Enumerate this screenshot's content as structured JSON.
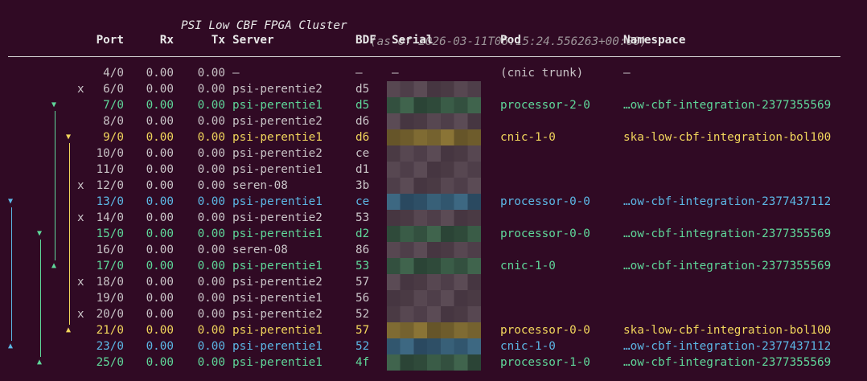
{
  "title": {
    "main": "PSI Low CBF FPGA Cluster",
    "as_of": "(as of 2026-03-11T06:15:24.556263+00:00)"
  },
  "columns": {
    "port": "Port",
    "rx": "Rx",
    "tx": "Tx",
    "server": "Server",
    "bdf": "BDF",
    "serial": "Serial",
    "pod": "Pod",
    "namespace": "Namespace"
  },
  "colors": {
    "background": "#300a24",
    "dim": "#c9c4c7",
    "green": "#5fd89a",
    "yellow": "#f2d65c",
    "blue": "#5cb8e6"
  },
  "rows": [
    {
      "mark": "",
      "port": "4/0",
      "rx": "0.00",
      "tx": "0.00",
      "server": "–",
      "bdf": "–",
      "serial": "–",
      "pod": "(cnic trunk)",
      "namespace": "–",
      "color": "dim"
    },
    {
      "mark": "x",
      "port": "6/0",
      "rx": "0.00",
      "tx": "0.00",
      "server": "psi-perentie2",
      "bdf": "d5",
      "serial": "",
      "pod": "",
      "namespace": "",
      "color": "dim"
    },
    {
      "mark": "",
      "port": "7/0",
      "rx": "0.00",
      "tx": "0.00",
      "server": "psi-perentie1",
      "bdf": "d5",
      "serial": "",
      "pod": "processor-2-0",
      "namespace": "…ow-cbf-integration-2377355569",
      "color": "green"
    },
    {
      "mark": "",
      "port": "8/0",
      "rx": "0.00",
      "tx": "0.00",
      "server": "psi-perentie2",
      "bdf": "d6",
      "serial": "",
      "pod": "",
      "namespace": "",
      "color": "dim"
    },
    {
      "mark": "",
      "port": "9/0",
      "rx": "0.00",
      "tx": "0.00",
      "server": "psi-perentie1",
      "bdf": "d6",
      "serial": "",
      "pod": "cnic-1-0",
      "namespace": "ska-low-cbf-integration-bol100",
      "color": "yellow"
    },
    {
      "mark": "",
      "port": "10/0",
      "rx": "0.00",
      "tx": "0.00",
      "server": "psi-perentie2",
      "bdf": "ce",
      "serial": "",
      "pod": "",
      "namespace": "",
      "color": "dim"
    },
    {
      "mark": "",
      "port": "11/0",
      "rx": "0.00",
      "tx": "0.00",
      "server": "psi-perentie1",
      "bdf": "d1",
      "serial": "",
      "pod": "",
      "namespace": "",
      "color": "dim"
    },
    {
      "mark": "x",
      "port": "12/0",
      "rx": "0.00",
      "tx": "0.00",
      "server": "seren-08",
      "bdf": "3b",
      "serial": "",
      "pod": "",
      "namespace": "",
      "color": "dim"
    },
    {
      "mark": "",
      "port": "13/0",
      "rx": "0.00",
      "tx": "0.00",
      "server": "psi-perentie1",
      "bdf": "ce",
      "serial": "",
      "pod": "processor-0-0",
      "namespace": "…ow-cbf-integration-2377437112",
      "color": "blue"
    },
    {
      "mark": "x",
      "port": "14/0",
      "rx": "0.00",
      "tx": "0.00",
      "server": "psi-perentie2",
      "bdf": "53",
      "serial": "",
      "pod": "",
      "namespace": "",
      "color": "dim"
    },
    {
      "mark": "",
      "port": "15/0",
      "rx": "0.00",
      "tx": "0.00",
      "server": "psi-perentie1",
      "bdf": "d2",
      "serial": "",
      "pod": "processor-0-0",
      "namespace": "…ow-cbf-integration-2377355569",
      "color": "green"
    },
    {
      "mark": "",
      "port": "16/0",
      "rx": "0.00",
      "tx": "0.00",
      "server": "seren-08",
      "bdf": "86",
      "serial": "",
      "pod": "",
      "namespace": "",
      "color": "dim"
    },
    {
      "mark": "",
      "port": "17/0",
      "rx": "0.00",
      "tx": "0.00",
      "server": "psi-perentie1",
      "bdf": "53",
      "serial": "",
      "pod": "cnic-1-0",
      "namespace": "…ow-cbf-integration-2377355569",
      "color": "green"
    },
    {
      "mark": "x",
      "port": "18/0",
      "rx": "0.00",
      "tx": "0.00",
      "server": "psi-perentie2",
      "bdf": "57",
      "serial": "",
      "pod": "",
      "namespace": "",
      "color": "dim"
    },
    {
      "mark": "",
      "port": "19/0",
      "rx": "0.00",
      "tx": "0.00",
      "server": "psi-perentie1",
      "bdf": "56",
      "serial": "",
      "pod": "",
      "namespace": "",
      "color": "dim"
    },
    {
      "mark": "x",
      "port": "20/0",
      "rx": "0.00",
      "tx": "0.00",
      "server": "psi-perentie2",
      "bdf": "52",
      "serial": "",
      "pod": "",
      "namespace": "",
      "color": "dim"
    },
    {
      "mark": "",
      "port": "21/0",
      "rx": "0.00",
      "tx": "0.00",
      "server": "psi-perentie1",
      "bdf": "57",
      "serial": "",
      "pod": "processor-0-0",
      "namespace": "ska-low-cbf-integration-bol100",
      "color": "yellow"
    },
    {
      "mark": "",
      "port": "23/0",
      "rx": "0.00",
      "tx": "0.00",
      "server": "psi-perentie1",
      "bdf": "52",
      "serial": "",
      "pod": "cnic-1-0",
      "namespace": "…ow-cbf-integration-2377437112",
      "color": "blue"
    },
    {
      "mark": "",
      "port": "25/0",
      "rx": "0.00",
      "tx": "0.00",
      "server": "psi-perentie1",
      "bdf": "4f",
      "serial": "",
      "pod": "processor-1-0",
      "namespace": "…ow-cbf-integration-2377355569",
      "color": "green"
    }
  ],
  "links": [
    {
      "from": 2,
      "to": 12,
      "color": "green"
    },
    {
      "from": 4,
      "to": 16,
      "color": "yellow"
    },
    {
      "from": 8,
      "to": 17,
      "color": "blue"
    },
    {
      "from": 10,
      "to": 18,
      "color": "green"
    }
  ],
  "link_arrows": {
    "down": "▼",
    "up": "▲"
  }
}
